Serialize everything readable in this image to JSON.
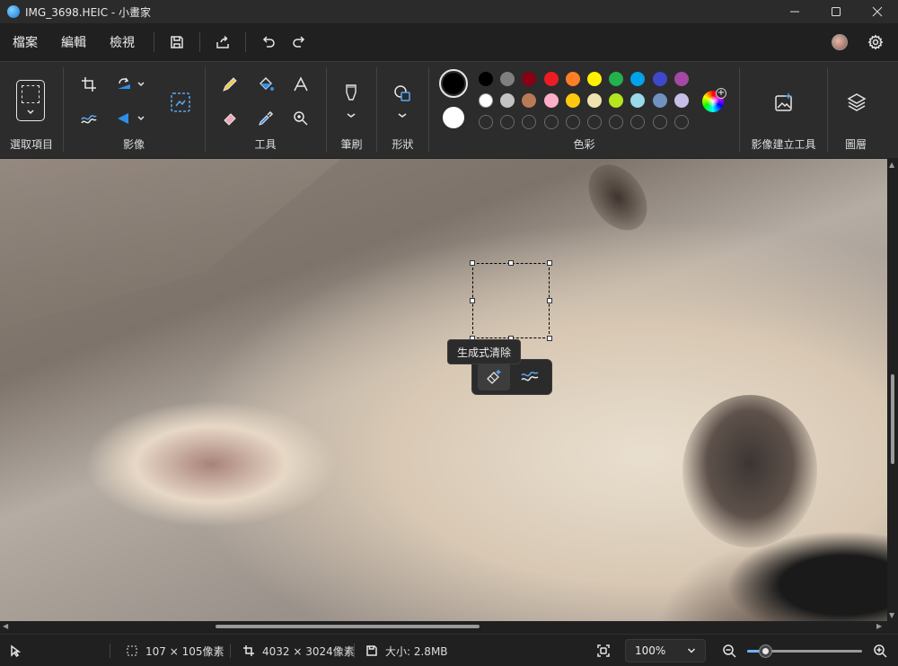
{
  "window": {
    "title": "IMG_3698.HEIC - 小畫家"
  },
  "menu": {
    "file": "檔案",
    "edit": "編輯",
    "view": "檢視"
  },
  "ribbon": {
    "select_label": "選取項目",
    "image_label": "影像",
    "tools_label": "工具",
    "brush_label": "筆刷",
    "shapes_label": "形狀",
    "colors_label": "色彩",
    "image_creator_label": "影像建立工具",
    "layers_label": "圖層"
  },
  "colors": {
    "primary": "#000000",
    "secondary": "#ffffff",
    "row1": [
      "#000000",
      "#7f7f7f",
      "#880015",
      "#ed1c24",
      "#ff7f27",
      "#fff200",
      "#22b14c",
      "#00a2e8",
      "#3f48cc",
      "#a349a4"
    ],
    "row2": [
      "#ffffff",
      "#c3c3c3",
      "#b97a57",
      "#ffaec9",
      "#ffc90e",
      "#efe4b0",
      "#b5e61d",
      "#99d9ea",
      "#7092be",
      "#c8bfe7"
    ],
    "custom_slots": 10
  },
  "canvas": {
    "tooltip": "生成式清除"
  },
  "status": {
    "selection_size": "107 × 105像素",
    "image_size": "4032 × 3024像素",
    "file_size": "大小: 2.8MB",
    "zoom": "100%",
    "zoom_slider_fraction": 0.16
  }
}
